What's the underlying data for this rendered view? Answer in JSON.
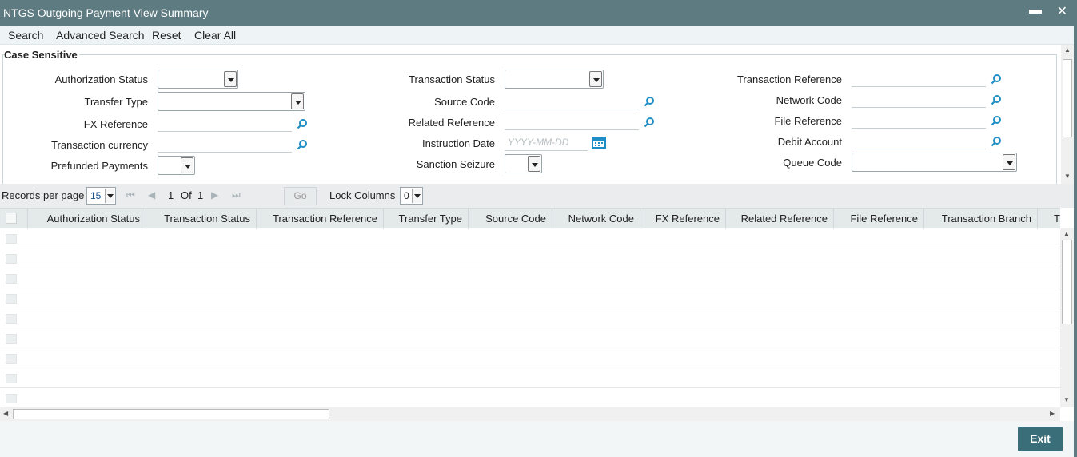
{
  "window": {
    "title": "NTGS Outgoing Payment View Summary",
    "minimize_glyph": "▬",
    "close_glyph": "✕"
  },
  "menu": [
    "Search",
    "Advanced Search",
    "Reset",
    "Clear All"
  ],
  "search_panel": {
    "legend": "Case Sensitive",
    "col1": {
      "authorization_status": "Authorization Status",
      "transfer_type": "Transfer Type",
      "fx_reference": "FX Reference",
      "transaction_currency": "Transaction currency",
      "prefunded_payments": "Prefunded Payments"
    },
    "col2": {
      "transaction_status": "Transaction Status",
      "source_code": "Source Code",
      "related_reference": "Related Reference",
      "instruction_date": "Instruction Date",
      "instruction_date_placeholder": "YYYY-MM-DD",
      "sanction_seizure": "Sanction Seizure"
    },
    "col3": {
      "transaction_reference": "Transaction Reference",
      "network_code": "Network Code",
      "file_reference": "File Reference",
      "debit_account": "Debit Account",
      "queue_code": "Queue Code"
    }
  },
  "pager": {
    "records_per_page_label": "Records per page",
    "records_per_page_value": "15",
    "current_page": "1",
    "of_label": "Of",
    "total_pages": "1",
    "go_label": "Go",
    "lock_columns_label": "Lock Columns",
    "lock_columns_value": "0"
  },
  "grid": {
    "columns": [
      "Authorization Status",
      "Transaction Status",
      "Transaction Reference",
      "Transfer Type",
      "Source Code",
      "Network Code",
      "FX Reference",
      "Related Reference",
      "File Reference",
      "Transaction Branch",
      "T"
    ],
    "empty_rows": 9
  },
  "footer": {
    "exit_label": "Exit"
  },
  "colors": {
    "titlebar": "#5e7b82",
    "exit_button": "#3a6f79",
    "lens_icon": "#1e8fc6"
  }
}
